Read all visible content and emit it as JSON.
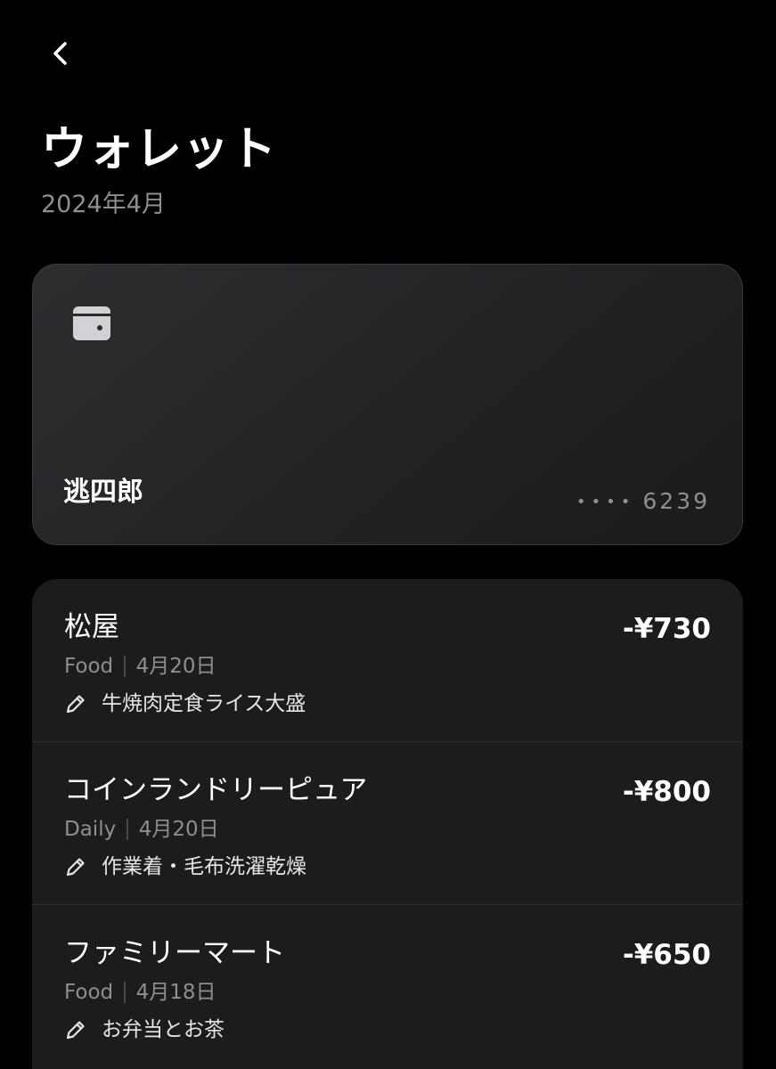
{
  "header": {
    "back_icon": "chevron-left-icon",
    "title": "ウォレット",
    "subtitle": "2024年4月"
  },
  "card": {
    "icon": "wallet-icon",
    "holder": "逃四郎",
    "masked_dots": "••••",
    "last4": "6239"
  },
  "transactions": [
    {
      "merchant": "松屋",
      "amount": "-¥730",
      "category": "Food",
      "date": "4月20日",
      "note": "牛焼肉定食ライス大盛"
    },
    {
      "merchant": "コインランドリーピュア",
      "amount": "-¥800",
      "category": "Daily",
      "date": "4月20日",
      "note": "作業着・毛布洗濯乾燥"
    },
    {
      "merchant": "ファミリーマート",
      "amount": "-¥650",
      "category": "Food",
      "date": "4月18日",
      "note": "お弁当とお茶"
    }
  ],
  "colors": {
    "background": "#000000",
    "card": "#232326",
    "list": "#1c1c1e",
    "secondary_text": "#8e8e93"
  }
}
